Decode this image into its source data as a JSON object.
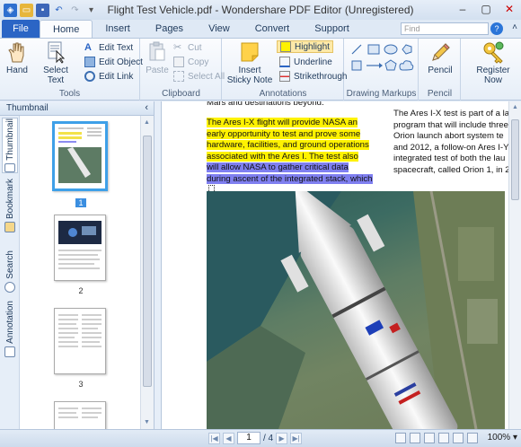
{
  "window": {
    "title": "Flight Test Vehicle.pdf - Wondershare PDF Editor (Unregistered)",
    "controls": [
      "–",
      "▢",
      "✕"
    ]
  },
  "quick_access": [
    "app-icon",
    "open-icon",
    "save-icon",
    "undo-icon",
    "redo-icon"
  ],
  "tabs": {
    "file": "File",
    "items": [
      "Home",
      "Insert",
      "Pages",
      "View",
      "Convert",
      "Support"
    ],
    "active": "Home",
    "search_placeholder": "Find",
    "help": "?"
  },
  "ribbon": {
    "tools": {
      "label": "Tools",
      "hand": "Hand",
      "select_text": "Select Text",
      "edit_text": "Edit Text",
      "edit_object": "Edit Object",
      "edit_link": "Edit Link"
    },
    "clipboard": {
      "label": "Clipboard",
      "paste": "Paste",
      "cut": "Cut",
      "copy": "Copy",
      "select_all": "Select All"
    },
    "annotations": {
      "label": "Annotations",
      "sticky_note": "Insert Sticky Note",
      "highlight": "Highlight",
      "underline": "Underline",
      "strikethrough": "Strikethrough"
    },
    "drawing": {
      "label": "Drawing Markups"
    },
    "pencil": {
      "label": "Pencil",
      "button": "Pencil"
    },
    "register": {
      "button": "Register Now"
    }
  },
  "left_panel": {
    "title": "Thumbnail",
    "vtabs": [
      "Thumbnail",
      "Bookmark",
      "Search",
      "Annotation"
    ],
    "pages": [
      "1",
      "2",
      "3"
    ],
    "selected_page": "1"
  },
  "document": {
    "top_line": "Mars and destinations beyond.",
    "highlight_yellow": [
      "The Ares I-X flight will provide NASA an",
      "early opportunity to test and prove some",
      "hardware, facilities, and ground operations",
      "associated with the Ares I. The test also"
    ],
    "highlight_blue": [
      "will allow NASA to gather critical data",
      "during ascent of the integrated stack, which"
    ],
    "right_column": [
      "The Ares I-X test is part of a la",
      "program that will include three",
      "Orion launch abort system te",
      "and 2012, a follow-on Ares I-Y",
      "integrated test of both the lau",
      "spacecraft, called Orion 1, in 2"
    ]
  },
  "statusbar": {
    "current_page": "1",
    "total_pages": "/ 4",
    "zoom": "100%"
  },
  "colors": {
    "accent": "#2b65c5",
    "highlight_yellow": "#fff200",
    "highlight_blue": "#7f7ff0",
    "thumb_selected": "#3ea0e8"
  }
}
